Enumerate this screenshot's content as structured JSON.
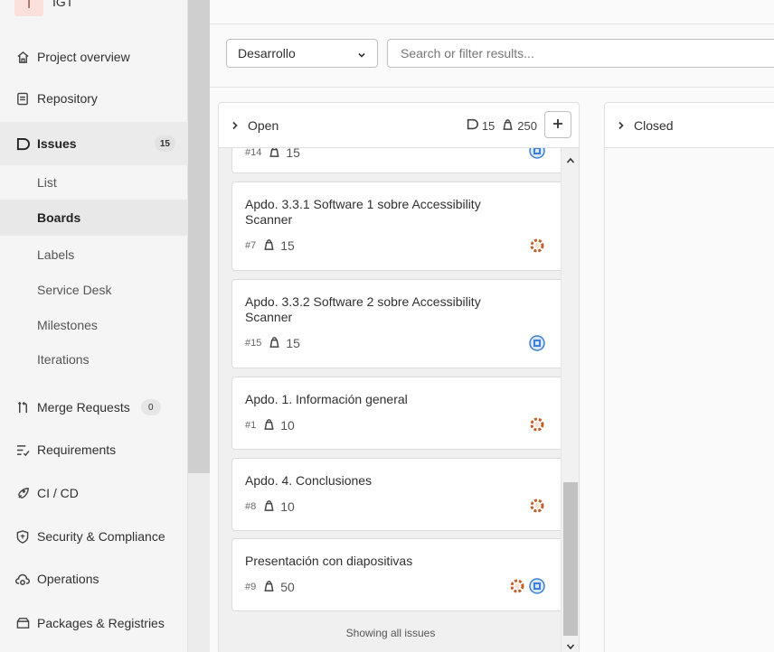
{
  "project": {
    "initial": "I",
    "name": "IGT"
  },
  "sidebar": {
    "items": [
      {
        "label": "Project overview",
        "icon": "home-icon"
      },
      {
        "label": "Repository",
        "icon": "document-icon"
      },
      {
        "label": "Issues",
        "icon": "issues-icon",
        "count": "15"
      },
      {
        "label": "Merge Requests",
        "icon": "merge-request-icon",
        "count": "0"
      },
      {
        "label": "Requirements",
        "icon": "requirements-icon"
      },
      {
        "label": "CI / CD",
        "icon": "rocket-icon"
      },
      {
        "label": "Security & Compliance",
        "icon": "shield-icon"
      },
      {
        "label": "Operations",
        "icon": "cloud-gear-icon"
      },
      {
        "label": "Packages & Registries",
        "icon": "package-icon"
      }
    ],
    "issues_sub": [
      "List",
      "Boards",
      "Labels",
      "Service Desk",
      "Milestones",
      "Iterations"
    ]
  },
  "filter": {
    "board_select": "Desarrollo",
    "search_placeholder": "Search or filter results..."
  },
  "lists": {
    "open": {
      "title": "Open",
      "issue_count": "15",
      "weight": "250"
    },
    "closed": {
      "title": "Closed"
    }
  },
  "cards": [
    {
      "title": "",
      "number": "#14",
      "weight": "15"
    },
    {
      "title": "Apdo. 3.3.1 Software 1 sobre Accessibility Scanner",
      "number": "#7",
      "weight": "15"
    },
    {
      "title": "Apdo. 3.3.2 Software 2 sobre Accessibility Scanner",
      "number": "#15",
      "weight": "15"
    },
    {
      "title": "Apdo. 1. Información general",
      "number": "#1",
      "weight": "10"
    },
    {
      "title": "Apdo. 4. Conclusiones",
      "number": "#8",
      "weight": "10"
    },
    {
      "title": "Presentación con diapositivas",
      "number": "#9",
      "weight": "50"
    }
  ],
  "footer": "Showing all issues",
  "colors": {
    "avatar_orange": "#c2602a",
    "avatar_blue": "#3d7fd6",
    "active_bg": "#ebebeb"
  }
}
